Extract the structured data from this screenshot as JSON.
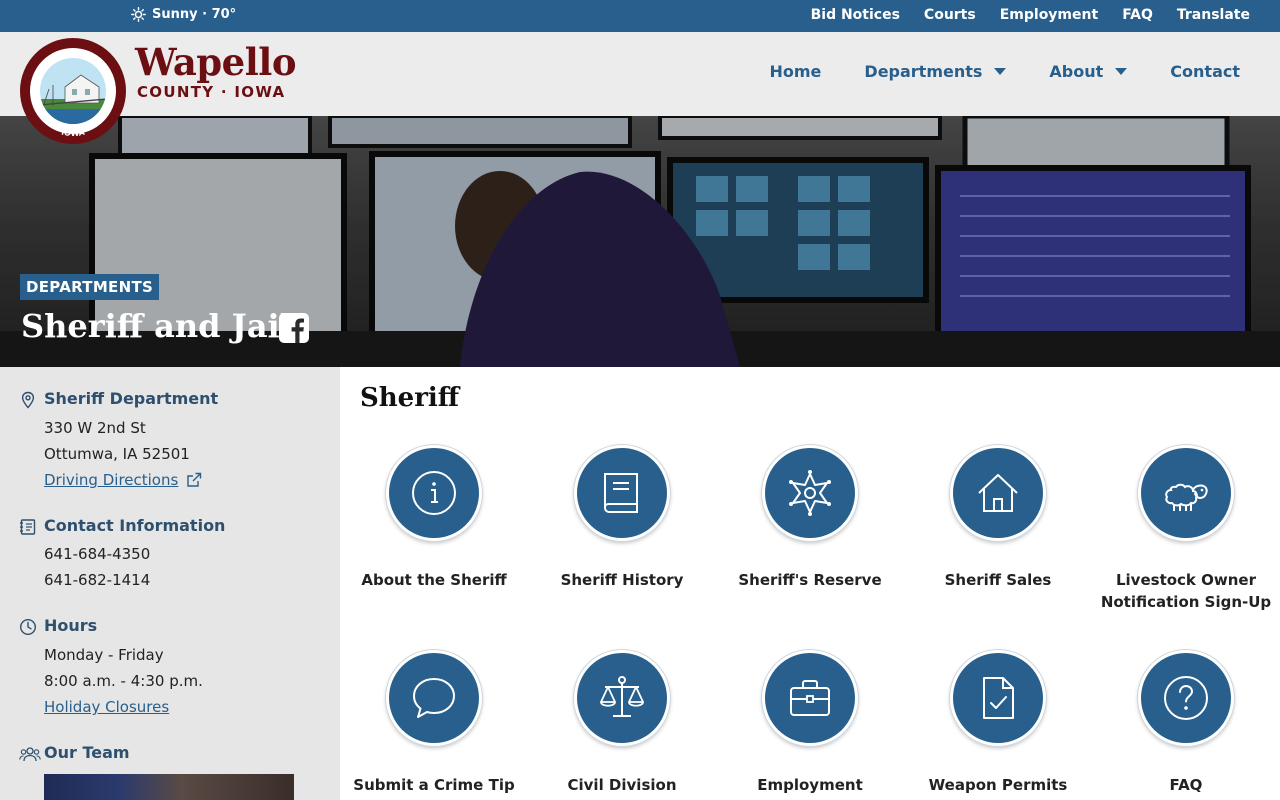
{
  "topbar": {
    "weather": "Sunny · 70°",
    "links": [
      "Bid Notices",
      "Courts",
      "Employment",
      "FAQ",
      "Translate"
    ]
  },
  "brand": {
    "name": "Wapello",
    "sub": "COUNTY · IOWA",
    "seal_top": "WAPELLO COUNTY",
    "seal_bottom": "IOWA"
  },
  "nav": {
    "home": "Home",
    "departments": "Departments",
    "about": "About",
    "contact": "Contact"
  },
  "hero": {
    "tag": "DEPARTMENTS",
    "title": "Sheriff and Jail"
  },
  "sidebar": {
    "location": {
      "heading": "Sheriff Department",
      "address1": "330 W 2nd St",
      "address2": "Ottumwa, IA 52501",
      "directions": "Driving Directions"
    },
    "contact": {
      "heading": "Contact Information",
      "phone1": "641-684-4350",
      "phone2": "641-682-1414"
    },
    "hours": {
      "heading": "Hours",
      "days": "Monday - Friday",
      "time": "8:00 a.m. - 4:30 p.m.",
      "closures": "Holiday Closures"
    },
    "team": {
      "heading": "Our Team"
    }
  },
  "main": {
    "title": "Sheriff",
    "tiles": [
      {
        "label": "About the Sheriff",
        "icon": "info-icon"
      },
      {
        "label": "Sheriff History",
        "icon": "book-icon"
      },
      {
        "label": "Sheriff's Reserve",
        "icon": "star-badge-icon"
      },
      {
        "label": "Sheriff Sales",
        "icon": "house-icon"
      },
      {
        "label": "Livestock Owner Notification Sign-Up",
        "icon": "sheep-icon"
      },
      {
        "label": "Submit a Crime Tip",
        "icon": "speech-bubble-icon"
      },
      {
        "label": "Civil Division",
        "icon": "scales-icon"
      },
      {
        "label": "Employment",
        "icon": "briefcase-icon"
      },
      {
        "label": "Weapon Permits",
        "icon": "document-check-icon"
      },
      {
        "label": "FAQ",
        "icon": "question-icon"
      }
    ]
  },
  "colors": {
    "brand_blue": "#285f8c",
    "brand_maroon": "#6b0f12",
    "sidebar_bg": "#e6e6e6",
    "header_bg": "#ececec"
  }
}
